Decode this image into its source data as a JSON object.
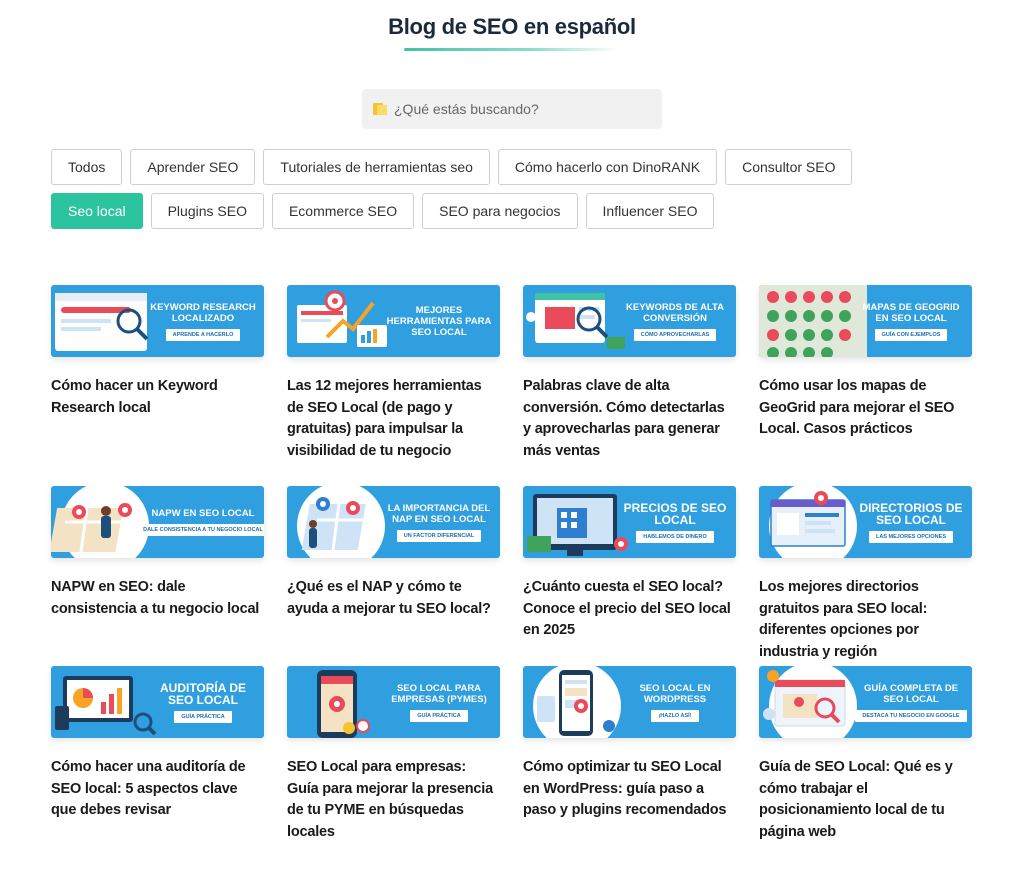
{
  "header": {
    "title": "Blog de SEO en español"
  },
  "search": {
    "placeholder": "¿Qué estás buscando?",
    "icon": "search-icon"
  },
  "filters": [
    {
      "label": "Todos",
      "active": false
    },
    {
      "label": "Aprender SEO",
      "active": false
    },
    {
      "label": "Tutoriales de herramientas seo",
      "active": false
    },
    {
      "label": "Cómo hacerlo con DinoRANK",
      "active": false
    },
    {
      "label": "Consultor SEO",
      "active": false
    },
    {
      "label": "Seo local",
      "active": true
    },
    {
      "label": "Plugins SEO",
      "active": false
    },
    {
      "label": "Ecommerce SEO",
      "active": false
    },
    {
      "label": "SEO para negocios",
      "active": false
    },
    {
      "label": "Influencer SEO",
      "active": false
    }
  ],
  "colors": {
    "accent": "#2cc49f",
    "banner_blue": "#2f9fe0",
    "title_underline": "#3fc3a4"
  },
  "posts": [
    {
      "banner_title": "Keyword research localizado",
      "banner_tag": "Aprende a hacerlo",
      "title": "Cómo hacer un Keyword Research local"
    },
    {
      "banner_title": "Mejores herramientas para SEO local",
      "banner_tag": "",
      "title": "Las 12 mejores herramientas de SEO Local (de pago y gratuitas) para impulsar la visibilidad de tu negocio"
    },
    {
      "banner_title": "Keywords de alta conversión",
      "banner_tag": "Cómo aprovecharlas",
      "title": "Palabras clave de alta conversión. Cómo detectarlas y aprovecharlas para generar más ventas"
    },
    {
      "banner_title": "Mapas de GeoGrid en SEO local",
      "banner_tag": "Guía con ejemplos",
      "title": "Cómo usar los mapas de GeoGrid para mejorar el SEO Local. Casos prácticos"
    },
    {
      "banner_title": "NAPW en SEO local",
      "banner_tag": "Dale consistencia a tu negocio local",
      "title": "NAPW en SEO: dale consistencia a tu negocio local"
    },
    {
      "banner_title": "La importancia del NAP en SEO local",
      "banner_tag": "Un factor diferencial",
      "title": "¿Qué es el NAP y cómo te ayuda a mejorar tu SEO local?"
    },
    {
      "banner_title": "Precios de SEO local",
      "banner_tag": "Hablemos de dinero",
      "title": "¿Cuánto cuesta el SEO local? Conoce el precio del SEO local en 2025"
    },
    {
      "banner_title": "Directorios de SEO local",
      "banner_tag": "Las mejores opciones",
      "title": "Los mejores directorios gratuitos para SEO local: diferentes opciones por industria y región"
    },
    {
      "banner_title": "Auditoría de SEO local",
      "banner_tag": "Guía práctica",
      "title": "Cómo hacer una auditoría de SEO local: 5 aspectos clave que debes revisar"
    },
    {
      "banner_title": "SEO local para empresas (PYMES)",
      "banner_tag": "Guía práctica",
      "title": "SEO Local para empresas: Guía para mejorar la presencia de tu PYME en búsquedas locales"
    },
    {
      "banner_title": "SEO local en WordPress",
      "banner_tag": "¡Hazlo así!",
      "title": "Cómo optimizar tu SEO Local en WordPress: guía paso a paso y plugins recomendados"
    },
    {
      "banner_title": "Guía completa de SEO local",
      "banner_tag": "Destaca tu negocio en Google",
      "title": "Guía de SEO Local: Qué es y cómo trabajar el posicionamiento local de tu página web"
    }
  ]
}
